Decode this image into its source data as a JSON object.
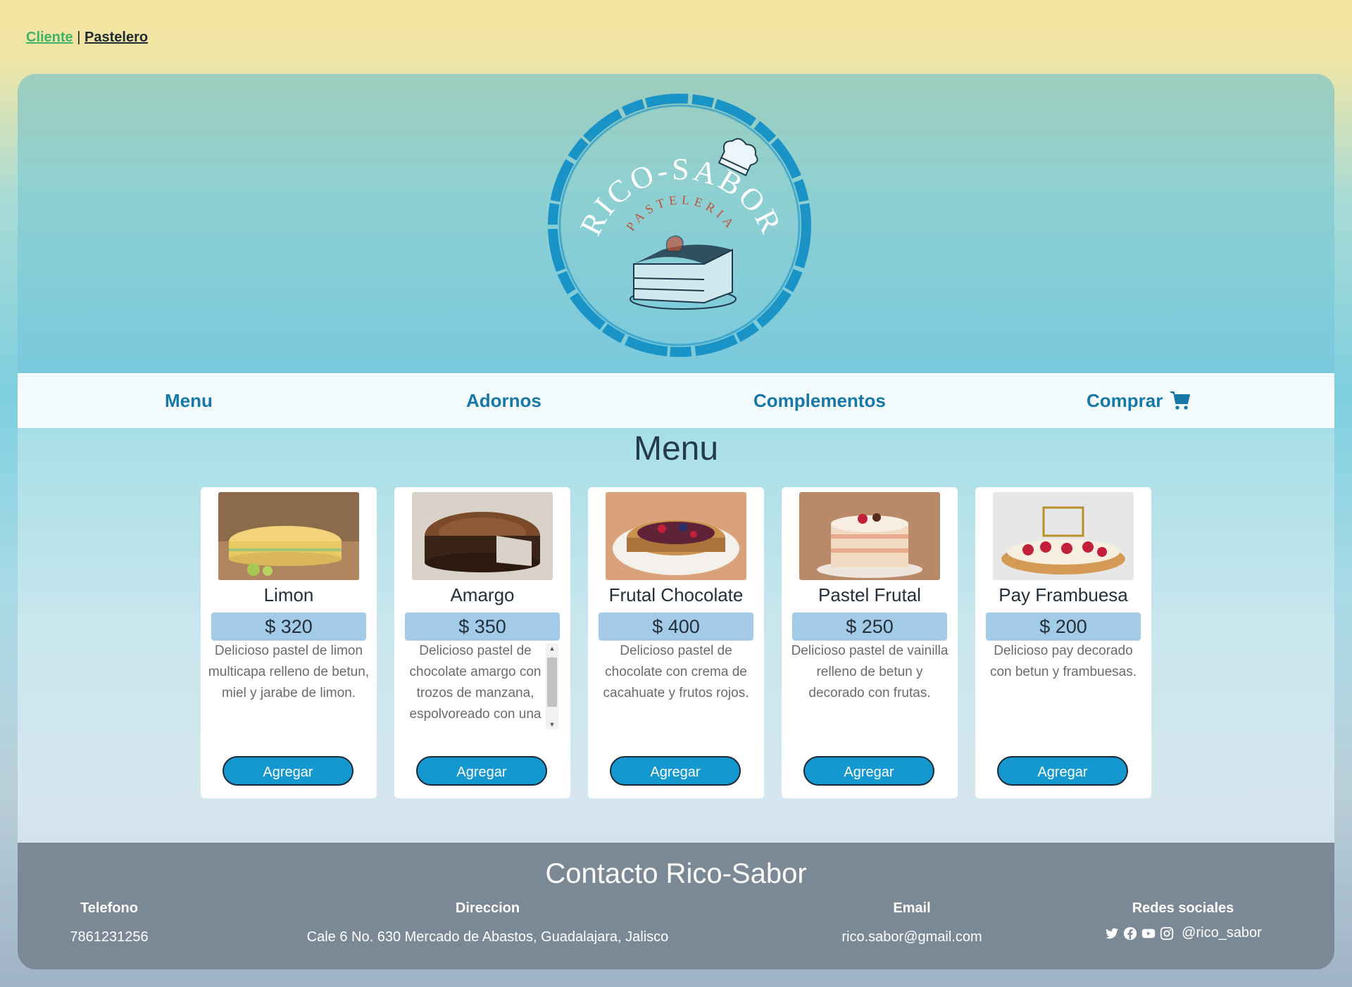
{
  "top_links": {
    "cliente": "Cliente",
    "separator": "|",
    "pastelero": "Pastelero"
  },
  "logo": {
    "brand": "RICO-SABOR",
    "sub": "PASTELERIA"
  },
  "nav": {
    "menu": "Menu",
    "adornos": "Adornos",
    "complementos": "Complementos",
    "comprar": "Comprar",
    "cart_icon": "shopping-cart-icon"
  },
  "section": {
    "title": "Menu"
  },
  "products": [
    {
      "name": "Limon",
      "price": "$ 320",
      "description": "Delicioso pastel de limon multicapa relleno de betun, miel y jarabe de limon.",
      "button": "Agregar"
    },
    {
      "name": "Amargo",
      "price": "$ 350",
      "description": "Delicioso pastel de chocolate amargo con trozos de manzana, espolvoreado con una",
      "button": "Agregar"
    },
    {
      "name": "Frutal Chocolate",
      "price": "$ 400",
      "description": "Delicioso pastel de chocolate con crema de cacahuate y frutos rojos.",
      "button": "Agregar"
    },
    {
      "name": "Pastel Frutal",
      "price": "$ 250",
      "description": "Delicioso pastel de vainilla relleno de betun y decorado con frutas.",
      "button": "Agregar"
    },
    {
      "name": "Pay Frambuesa",
      "price": "$ 200",
      "description": "Delicioso pay decorado con betun y frambuesas.",
      "button": "Agregar"
    }
  ],
  "footer": {
    "title": "Contacto Rico-Sabor",
    "telefono_label": "Telefono",
    "telefono": "7861231256",
    "direccion_label": "Direccion",
    "direccion": "Cale 6 No. 630 Mercado de Abastos, Guadalajara, Jalisco",
    "email_label": "Email",
    "email": "rico.sabor@gmail.com",
    "redes_label": "Redes sociales",
    "handle": "@rico_sabor",
    "icons": [
      "twitter-icon",
      "facebook-icon",
      "youtube-icon",
      "instagram-icon"
    ]
  },
  "colors": {
    "accent": "#1578a7",
    "button": "#1597cf",
    "price_bg": "#a3cbe8",
    "footer_bg": "#7a8995",
    "link_green": "#3fb36a"
  }
}
